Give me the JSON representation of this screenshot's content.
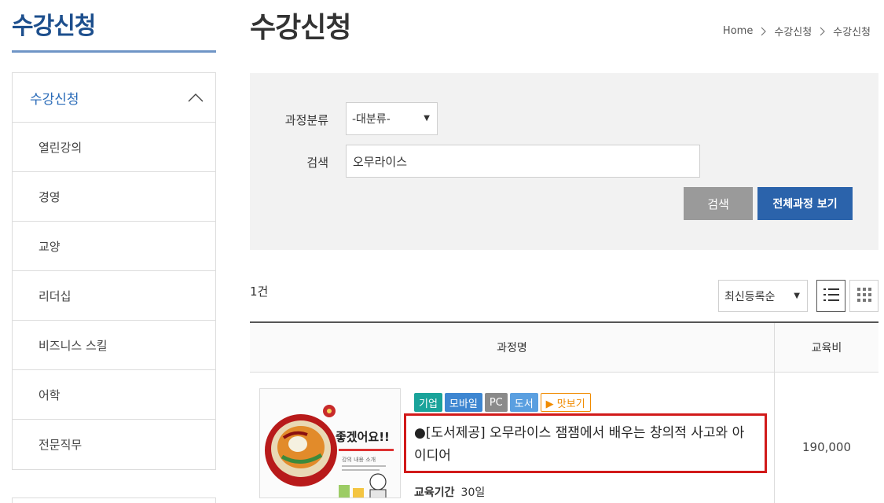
{
  "sidebar": {
    "title": "수강신청",
    "menu_head": "수강신청",
    "items": [
      {
        "label": "열린강의"
      },
      {
        "label": "경영"
      },
      {
        "label": "교양"
      },
      {
        "label": "리더십"
      },
      {
        "label": "비즈니스 스킬"
      },
      {
        "label": "어학"
      },
      {
        "label": "전문직무"
      }
    ]
  },
  "header": {
    "title": "수강신청",
    "breadcrumb": [
      "Home",
      "수강신청",
      "수강신청"
    ]
  },
  "search": {
    "category_label": "과정분류",
    "category_value": "-대분류-",
    "keyword_label": "검색",
    "keyword_value": "오무라이스",
    "search_button": "검색",
    "all_button": "전체과정 보기"
  },
  "results": {
    "count": "1건",
    "sort_value": "최신등록순"
  },
  "table": {
    "header_name": "과정명",
    "header_fee": "교육비",
    "rows": [
      {
        "badges": [
          {
            "label": "기업",
            "color": "#1aa39a"
          },
          {
            "label": "모바일",
            "color": "#3d86d1"
          },
          {
            "label": "PC",
            "color": "#8a8a8a"
          },
          {
            "label": "도서",
            "color": "#5a9fe0"
          }
        ],
        "preview_label": "▶ 맛보기",
        "title": "●[도서제공] 오무라이스 잼잼에서 배우는 창의적 사고와 아이디어",
        "period_label": "교육기간",
        "period_value": "30일",
        "fee": "190,000",
        "thumbnail": {
          "headline": "좋겠어요!!",
          "sub": "강의 내용 소개"
        }
      }
    ]
  },
  "colors": {
    "brand_blue": "#2b63ab",
    "highlight_red": "#d11a1a"
  }
}
